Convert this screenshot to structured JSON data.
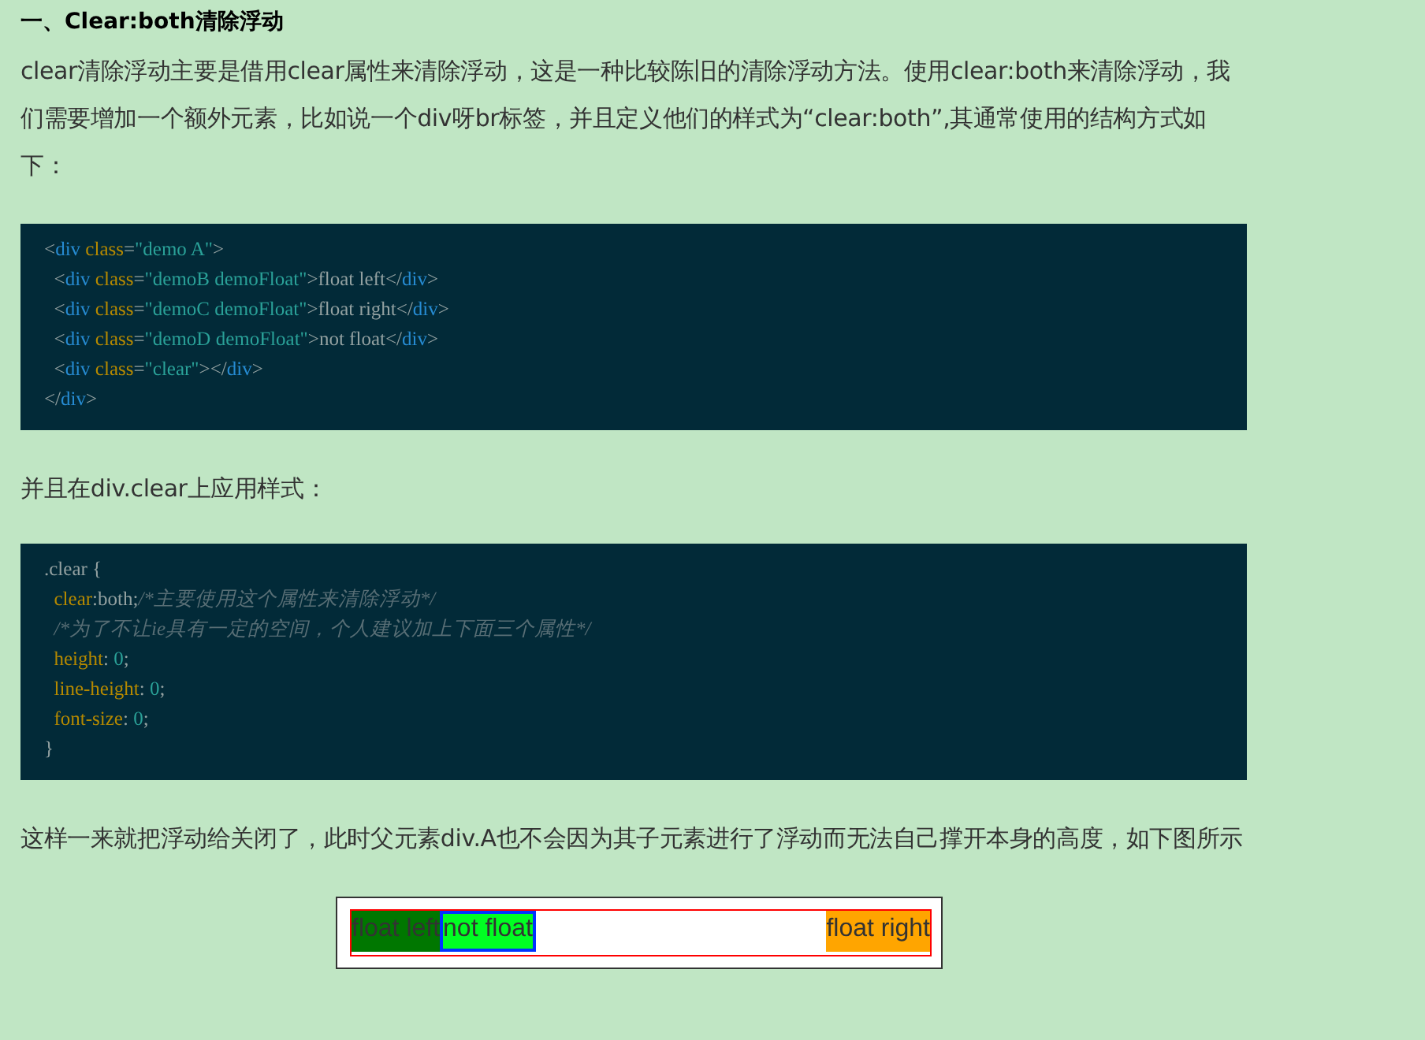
{
  "heading": "一、Clear:both清除浮动",
  "intro": "clear清除浮动主要是借用clear属性来清除浮动，这是一种比较陈旧的清除浮动方法。使用clear:both来清除浮动，我们需要增加一个额外元素，比如说一个div呀br标签，并且定义他们的样式为“clear:both”,其通常使用的结构方式如下：",
  "code_html": [
    {
      "tokens": [
        {
          "kind": "punct",
          "text": "<"
        },
        {
          "kind": "tag",
          "text": "div"
        },
        {
          "kind": "attr",
          "text": " class"
        },
        {
          "kind": "punct",
          "text": "="
        },
        {
          "kind": "string",
          "text": "\"demo A\""
        },
        {
          "kind": "punct",
          "text": ">"
        }
      ]
    },
    {
      "tokens": [
        {
          "kind": "punct",
          "text": "  <"
        },
        {
          "kind": "tag",
          "text": "div"
        },
        {
          "kind": "attr",
          "text": " class"
        },
        {
          "kind": "punct",
          "text": "="
        },
        {
          "kind": "string",
          "text": "\"demoB demoFloat\""
        },
        {
          "kind": "punct",
          "text": ">float left</"
        },
        {
          "kind": "tag",
          "text": "div"
        },
        {
          "kind": "punct",
          "text": ">"
        }
      ]
    },
    {
      "tokens": [
        {
          "kind": "punct",
          "text": "  <"
        },
        {
          "kind": "tag",
          "text": "div"
        },
        {
          "kind": "attr",
          "text": " class"
        },
        {
          "kind": "punct",
          "text": "="
        },
        {
          "kind": "string",
          "text": "\"demoC demoFloat\""
        },
        {
          "kind": "punct",
          "text": ">float right</"
        },
        {
          "kind": "tag",
          "text": "div"
        },
        {
          "kind": "punct",
          "text": ">"
        }
      ]
    },
    {
      "tokens": [
        {
          "kind": "punct",
          "text": "  <"
        },
        {
          "kind": "tag",
          "text": "div"
        },
        {
          "kind": "attr",
          "text": " class"
        },
        {
          "kind": "punct",
          "text": "="
        },
        {
          "kind": "string",
          "text": "\"demoD demoFloat\""
        },
        {
          "kind": "punct",
          "text": ">not float</"
        },
        {
          "kind": "tag",
          "text": "div"
        },
        {
          "kind": "punct",
          "text": ">"
        }
      ]
    },
    {
      "tokens": [
        {
          "kind": "punct",
          "text": "  <"
        },
        {
          "kind": "tag",
          "text": "div"
        },
        {
          "kind": "attr",
          "text": " class"
        },
        {
          "kind": "punct",
          "text": "="
        },
        {
          "kind": "string",
          "text": "\"clear\""
        },
        {
          "kind": "punct",
          "text": "></"
        },
        {
          "kind": "tag",
          "text": "div"
        },
        {
          "kind": "punct",
          "text": ">"
        }
      ]
    },
    {
      "tokens": [
        {
          "kind": "punct",
          "text": "</"
        },
        {
          "kind": "tag",
          "text": "div"
        },
        {
          "kind": "punct",
          "text": ">"
        }
      ]
    }
  ],
  "middle": "并且在div.clear上应用样式：",
  "code_css": [
    {
      "tokens": [
        {
          "kind": "punct",
          "text": ".clear {"
        }
      ]
    },
    {
      "tokens": [
        {
          "kind": "attr",
          "text": "  clear"
        },
        {
          "kind": "punct",
          "text": ":both;"
        },
        {
          "kind": "comment",
          "text": "/*主要使用这个属性来清除浮动*/"
        }
      ]
    },
    {
      "tokens": [
        {
          "kind": "comment",
          "text": "  /*为了不让ie具有一定的空间，个人建议加上下面三个属性*/"
        }
      ]
    },
    {
      "tokens": [
        {
          "kind": "attr",
          "text": "  height"
        },
        {
          "kind": "punct",
          "text": ": "
        },
        {
          "kind": "number",
          "text": "0"
        },
        {
          "kind": "punct",
          "text": ";"
        }
      ]
    },
    {
      "tokens": [
        {
          "kind": "attr",
          "text": "  line-height"
        },
        {
          "kind": "punct",
          "text": ": "
        },
        {
          "kind": "number",
          "text": "0"
        },
        {
          "kind": "punct",
          "text": ";"
        }
      ]
    },
    {
      "tokens": [
        {
          "kind": "attr",
          "text": "  font-size"
        },
        {
          "kind": "punct",
          "text": ": "
        },
        {
          "kind": "number",
          "text": "0"
        },
        {
          "kind": "punct",
          "text": ";"
        }
      ]
    },
    {
      "tokens": [
        {
          "kind": "punct",
          "text": "}"
        }
      ]
    }
  ],
  "outro": "这样一来就把浮动给关闭了，此时父元素div.A也不会因为其子元素进行了浮动而无法自己撑开本身的高度，如下图所示",
  "demo": [
    {
      "text": "float left",
      "kind": "left",
      "color": "#007700"
    },
    {
      "text": "not float",
      "kind": "none",
      "color": "#00ff22"
    },
    {
      "text": "float right",
      "kind": "right",
      "color": "#ffa500"
    }
  ]
}
